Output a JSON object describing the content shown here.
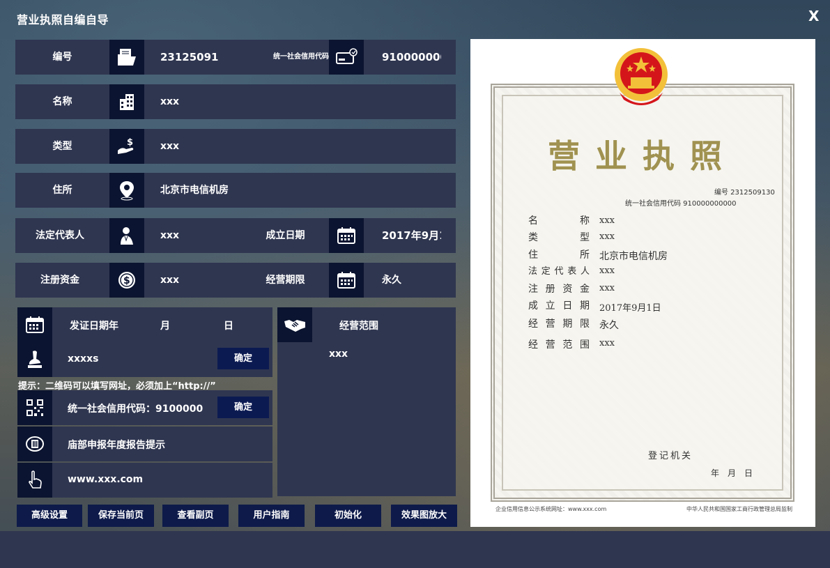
{
  "window": {
    "title": "营业执照自编自导",
    "close": "X"
  },
  "fields": {
    "number": {
      "label": "编号",
      "value": "2312509130"
    },
    "credit_code": {
      "label": "统一社会信用代码",
      "value": "910000000000"
    },
    "name": {
      "label": "名称",
      "value": "xxx"
    },
    "type": {
      "label": "类型",
      "value": "xxx"
    },
    "address": {
      "label": "住所",
      "value": "北京市电信机房"
    },
    "legal_rep": {
      "label": "法定代表人",
      "value": "xxx"
    },
    "established": {
      "label": "成立日期",
      "value": "2017年9月1日"
    },
    "capital": {
      "label": "注册资金",
      "value": "xxx"
    },
    "term": {
      "label": "经营期限",
      "value": "永久"
    }
  },
  "issue_date": {
    "label": "发证日期",
    "year": "年",
    "month": "月",
    "day": "日"
  },
  "seal": {
    "value": "xxxxs",
    "confirm": "确定"
  },
  "hint": "提示：二维码可以填写网址，必须加上“http://”",
  "qr": {
    "value": "统一社会信用代码：9100000",
    "confirm": "确定"
  },
  "annual_report": "庙部申报年度报告提示",
  "website": "www.xxx.com",
  "scope": {
    "label": "经营范围",
    "value": "xxx"
  },
  "buttons": {
    "advanced": "高级设置",
    "save": "保存当前页",
    "view_copy": "查看副页",
    "guide": "用户指南",
    "reset": "初始化",
    "zoom": "效果图放大"
  },
  "license": {
    "title": "营业执照",
    "number_line": "编号 2312509130",
    "credit_line": "统一社会信用代码 910000000000",
    "labels": [
      "名称",
      "类型",
      "住所",
      "法定代表人",
      "注册资金",
      "成立日期",
      "经营期限",
      "经营范围"
    ],
    "values": [
      "xxx",
      "xxx",
      "北京市电信机房",
      "xxx",
      "xxx",
      "2017年9月1日",
      "永久",
      "xxx"
    ],
    "authority": "登记机关",
    "date_line": "年　月　日",
    "footer_left": "企业信用信息公示系统网址：www.xxx.com",
    "footer_right": "中华人民共和国国家工商行政管理总局监制"
  },
  "colors": {
    "panel": "#2f3650",
    "icon_box": "#0b1430",
    "button": "#0d1a4a",
    "doc_title": "#a09250",
    "emblem_red": "#d4161b",
    "emblem_gold": "#f3c03a"
  }
}
